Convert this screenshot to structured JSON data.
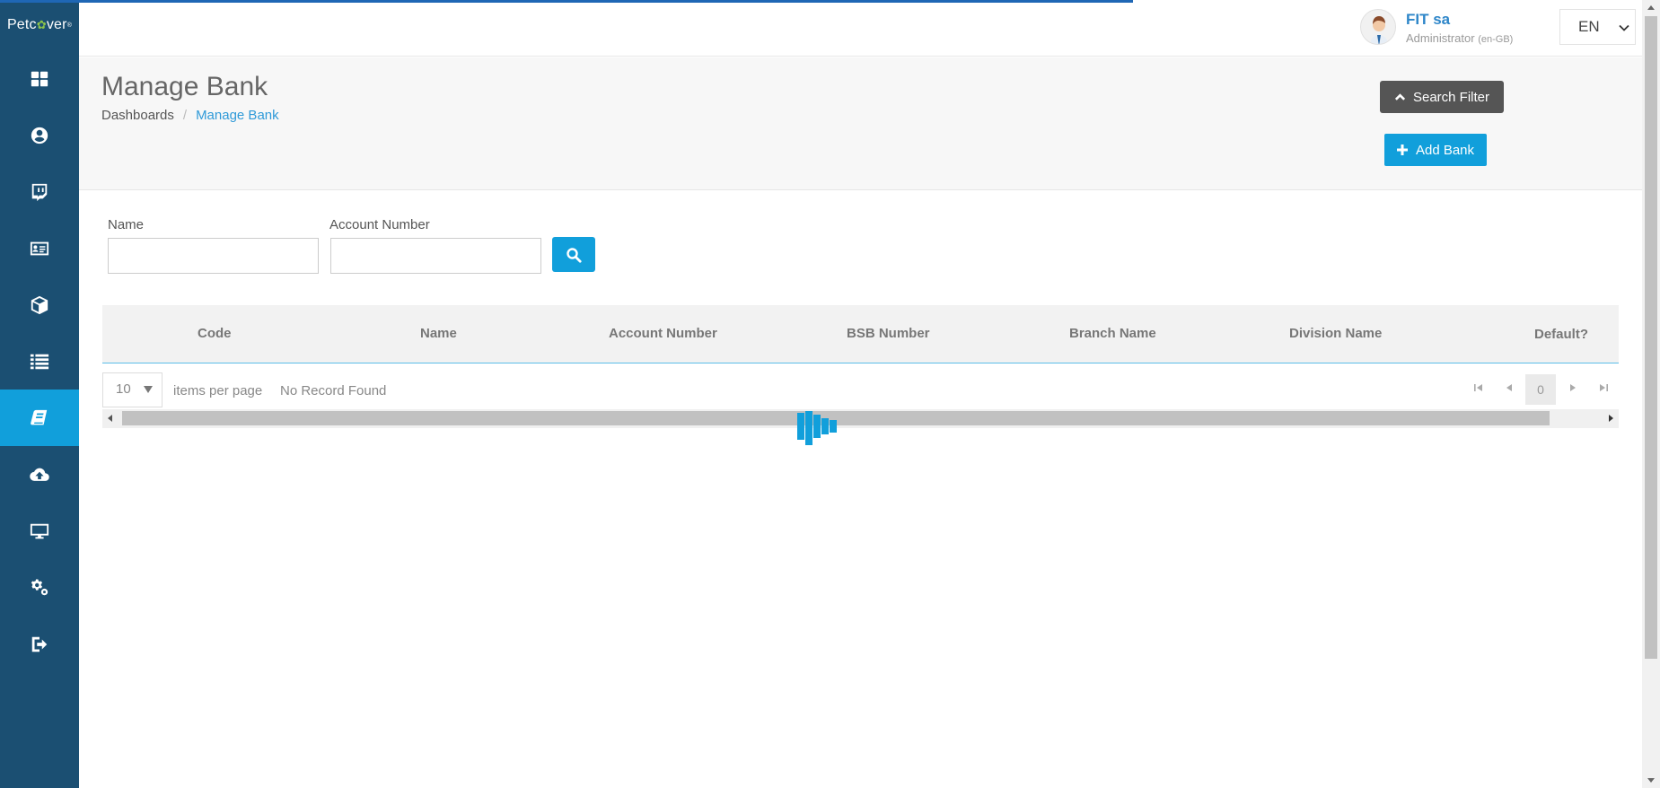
{
  "app": {
    "brand_prefix": "Petc",
    "brand_suffix": "ver",
    "brand_mark": "®"
  },
  "sidebar": {
    "items": [
      {
        "icon": "dashboard-icon",
        "active": false
      },
      {
        "icon": "user-circle-icon",
        "active": false
      },
      {
        "icon": "chat-icon",
        "active": false
      },
      {
        "icon": "id-card-icon",
        "active": false
      },
      {
        "icon": "cube-icon",
        "active": false
      },
      {
        "icon": "list-icon",
        "active": false
      },
      {
        "icon": "book-icon",
        "active": true
      },
      {
        "icon": "cloud-upload-icon",
        "active": false
      },
      {
        "icon": "monitor-icon",
        "active": false
      },
      {
        "icon": "gears-icon",
        "active": false
      },
      {
        "icon": "sign-out-icon",
        "active": false
      }
    ]
  },
  "user": {
    "name": "FIT sa",
    "role": "Administrator",
    "locale": "(en-GB)"
  },
  "language": {
    "selected": "EN"
  },
  "page": {
    "title": "Manage Bank",
    "breadcrumb": {
      "home": "Dashboards",
      "separator": "/",
      "current": "Manage Bank"
    },
    "search_filter_label": "Search Filter",
    "add_label": "Add Bank"
  },
  "filters": {
    "name_label": "Name",
    "name_value": "",
    "account_label": "Account Number",
    "account_value": ""
  },
  "table": {
    "columns": [
      "Code",
      "Name",
      "Account Number",
      "BSB Number",
      "Branch Name",
      "Division Name",
      "Default?"
    ]
  },
  "pager": {
    "page_size": "10",
    "items_per_page_label": "items per page",
    "status": "No Record Found",
    "current_page": "0"
  },
  "colors": {
    "sidebar": "#1b4f72",
    "accent": "#119fdb",
    "link": "#2f9ad8",
    "filter_button": "#555555"
  }
}
